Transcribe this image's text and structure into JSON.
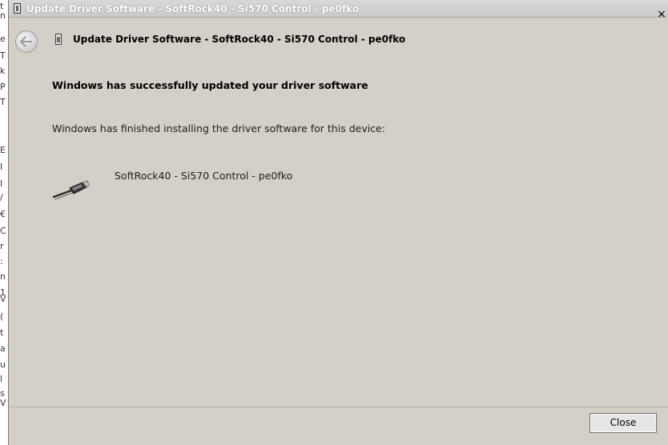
{
  "background": {
    "glyphs": [
      "t",
      "n",
      "e",
      "T",
      "k",
      "P",
      "T",
      "E",
      "I",
      "I",
      "/",
      "€",
      "C",
      "r",
      ":",
      "n",
      "1",
      "V",
      "(",
      "t",
      "a",
      "u",
      "l",
      "s",
      "V"
    ]
  },
  "window": {
    "title": "Update Driver Software - SoftRock40 - Si570 Control - pe0fko",
    "close_glyph": "×"
  },
  "nav": {
    "title": "Update Driver Software - SoftRock40 - Si570 Control - pe0fko"
  },
  "content": {
    "heading": "Windows has successfully updated your driver software",
    "message": "Windows has finished installing the driver software for this device:",
    "device_name": "SoftRock40 - Si570 Control - pe0fko"
  },
  "footer": {
    "close_label": "Close"
  },
  "icons": {
    "app": "device-icon",
    "back": "back-arrow-icon",
    "device_small": "device-icon",
    "usb": "usb-plug-icon",
    "window_close": "close-icon"
  }
}
